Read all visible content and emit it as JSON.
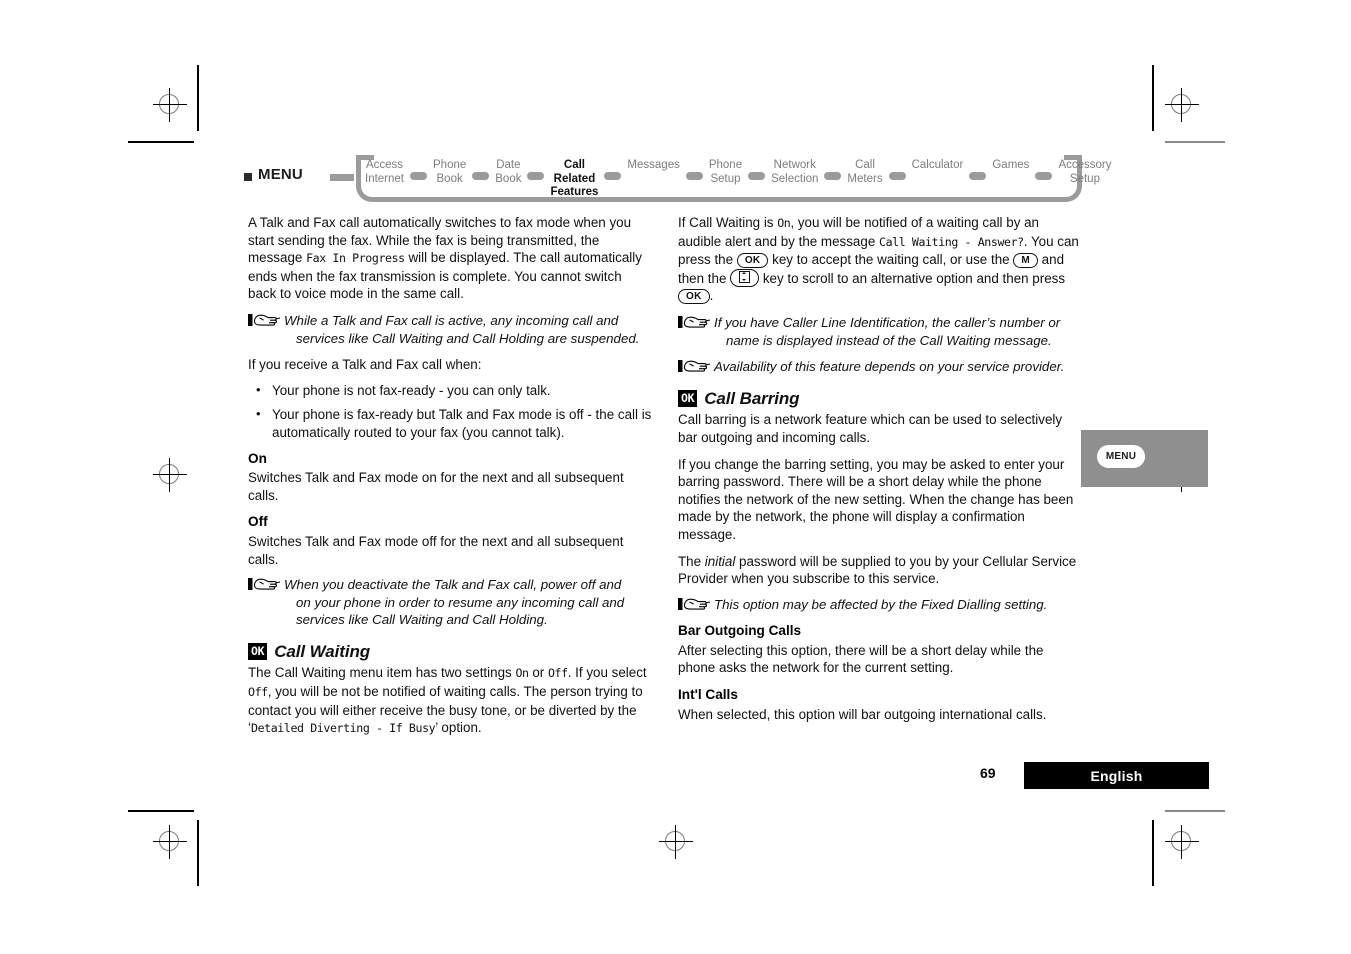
{
  "breadcrumb": {
    "menu_label": "MENU",
    "items": [
      {
        "label": "Access\nInternet",
        "active": false
      },
      {
        "label": "Phone\nBook",
        "active": false
      },
      {
        "label": "Date\nBook",
        "active": false
      },
      {
        "label": "Call Related\nFeatures",
        "active": true
      },
      {
        "label": "Messages",
        "active": false
      },
      {
        "label": "Phone\nSetup",
        "active": false
      },
      {
        "label": "Network\nSelection",
        "active": false
      },
      {
        "label": "Call\nMeters",
        "active": false
      },
      {
        "label": "Calculator",
        "active": false
      },
      {
        "label": "Games",
        "active": false
      },
      {
        "label": "Accessory\nSetup",
        "active": false
      }
    ]
  },
  "left_column": {
    "intro_p1_a": "A Talk and Fax call automatically switches to fax mode when you start sending the fax. While the fax is being transmitted, the message ",
    "intro_p1_lcd": "Fax In Progress",
    "intro_p1_b": " will be displayed. The call automatically ends when the fax transmission is complete. You cannot switch back to voice mode in the same call.",
    "note1_line1": "While a Talk and Fax call is active, any incoming call and",
    "note1_line2": "services like Call Waiting and Call Holding are suspended.",
    "receive_lead": "If you receive a Talk and Fax call when:",
    "bullets": [
      "Your phone is not fax-ready - you can only talk.",
      "Your phone is fax-ready but Talk and Fax mode is off - the call is automatically routed to your fax (you cannot talk)."
    ],
    "on_heading": "On",
    "on_body": "Switches Talk and Fax mode on for the next and all subsequent calls.",
    "off_heading": "Off",
    "off_body": "Switches Talk and Fax mode off for the next and all subsequent calls.",
    "note2_line1": "When you deactivate the Talk and Fax call, power off and",
    "note2_line2": "on your phone in order to resume any incoming call and",
    "note2_line3": "services like Call Waiting and Call Holding.",
    "call_waiting": {
      "badge": "OK",
      "title": "Call Waiting",
      "body_a": "The Call Waiting menu item has two settings ",
      "lcd_on": "On",
      "body_b": " or ",
      "lcd_off": "Off",
      "body_c": ". If you select ",
      "lcd_off2": "Off",
      "body_d": ", you will be not be notified of waiting calls. The person trying to contact you will either receive the busy tone, or be diverted by the ‘",
      "lcd_divert": "Detailed Diverting - If Busy",
      "body_e": "’ option."
    }
  },
  "right_column": {
    "cw_p_a": "If Call Waiting is ",
    "cw_lcd_on": "On",
    "cw_p_b": ", you will be notified of a waiting call by an audible alert and by the message ",
    "cw_lcd_msg": "Call Waiting - Answer?",
    "cw_p_c": ". You can press the ",
    "key_ok1": "OK",
    "cw_p_d": " key to accept the waiting call, or use the ",
    "key_m": "M",
    "cw_p_e": " and then the ",
    "key_scroll": "scroll-key",
    "cw_p_f": " key to scroll to an alternative option and then press ",
    "key_ok2": "OK",
    "cw_p_g": ".",
    "note3_line1": "If you have Caller Line Identification, the caller’s number or",
    "note3_line2": "name is displayed instead of the Call Waiting message.",
    "note4": "Availability of this feature depends on your service provider.",
    "call_barring": {
      "badge": "OK",
      "title": "Call Barring",
      "p1": "Call barring is a network feature which can be used to selectively bar outgoing and incoming calls.",
      "p2": "If you change the barring setting, you may be asked to enter your barring password. There will be a short delay while the phone notifies the network of the new setting. When the change has been made by the network, the phone will display a confirmation message.",
      "p3_a": "The ",
      "p3_italic": "initial",
      "p3_b": " password will be supplied to you by your Cellular Service Provider when you subscribe to this service.",
      "note5": "This option may be affected by the Fixed Dialling setting.",
      "bar_outgoing_heading": "Bar Outgoing Calls",
      "bar_outgoing_body": "After selecting this option, there will be a short delay while the phone asks the network for the current setting.",
      "intl_heading": "Int'l Calls",
      "intl_body": "When selected, this option will bar outgoing international calls."
    }
  },
  "side_tab": {
    "label": "MENU"
  },
  "footer": {
    "page_number": "69",
    "language": "English"
  }
}
